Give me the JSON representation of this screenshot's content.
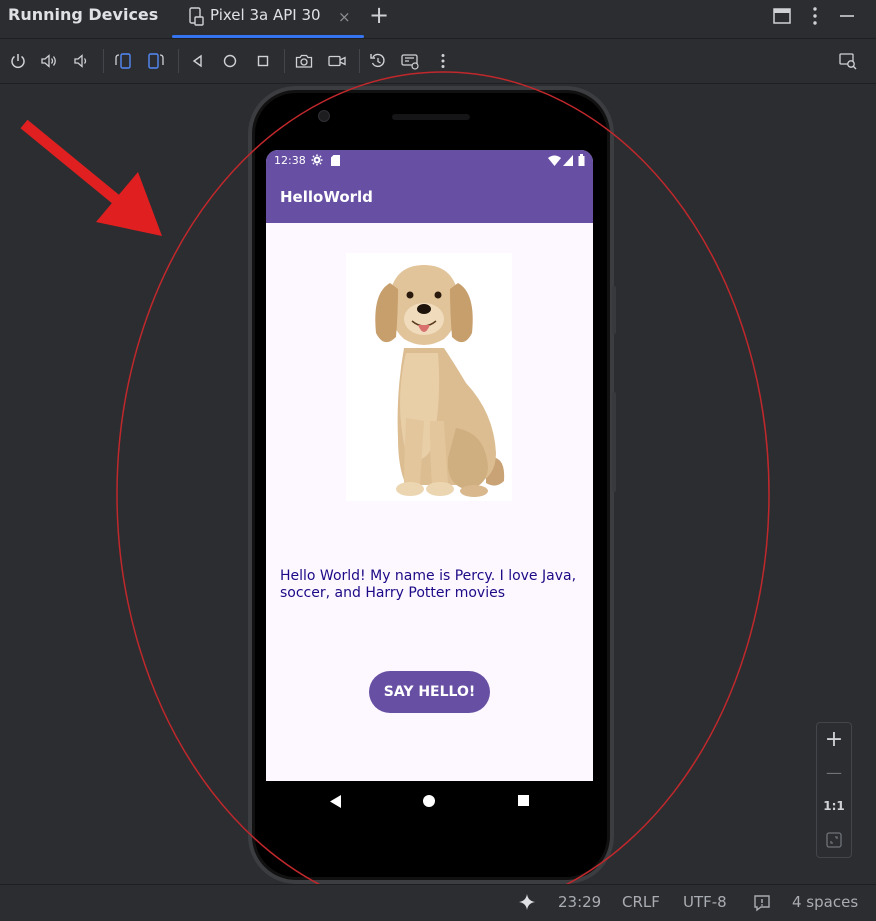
{
  "titlebar": {
    "title": "Running Devices",
    "tab_label": "Pixel 3a API 30",
    "tab_close": "×",
    "add_tab": "+"
  },
  "toolbar": {
    "icons": [
      "power-icon",
      "volume-up-icon",
      "volume-down-icon",
      "rotate-left-icon",
      "rotate-right-icon",
      "back-icon",
      "home-icon",
      "overview-icon",
      "screenshot-icon",
      "screen-record-icon",
      "reset-icon",
      "keyboard-icon",
      "more-icon",
      "device-inspect-icon"
    ]
  },
  "phone": {
    "status_time": "12:38",
    "app_title": "HelloWorld",
    "message": "Hello World! My name is Percy. I love Java, soccer, and Harry Potter movies",
    "button_label": "SAY HELLO!"
  },
  "zoom": {
    "plus": "+",
    "minus": "—",
    "one_to_one": "1:1"
  },
  "status": {
    "time": "23:29",
    "line_sep": "CRLF",
    "encoding": "UTF-8",
    "indent": "4 spaces"
  },
  "colors": {
    "accent": "#6750a4",
    "ide_bg": "#2b2d30",
    "annotation_red": "#e02020"
  }
}
